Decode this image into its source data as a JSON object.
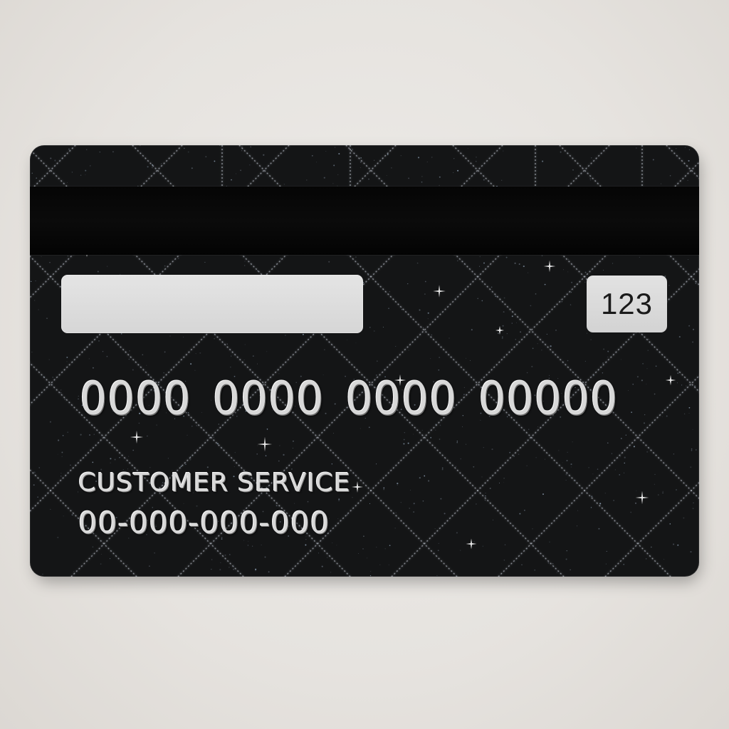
{
  "card": {
    "cvv": "123",
    "number": "0000 0000 0000 00000",
    "customer_service_label": "CUSTOMER SERVICE",
    "customer_service_phone": "00-000-000-000"
  },
  "colors": {
    "background": "#e8e5e1",
    "card_body": "#141516",
    "magnetic_stripe": "#050505",
    "signature_panel": "#dcdcdc",
    "embossed_text": "#d8d8d8"
  }
}
